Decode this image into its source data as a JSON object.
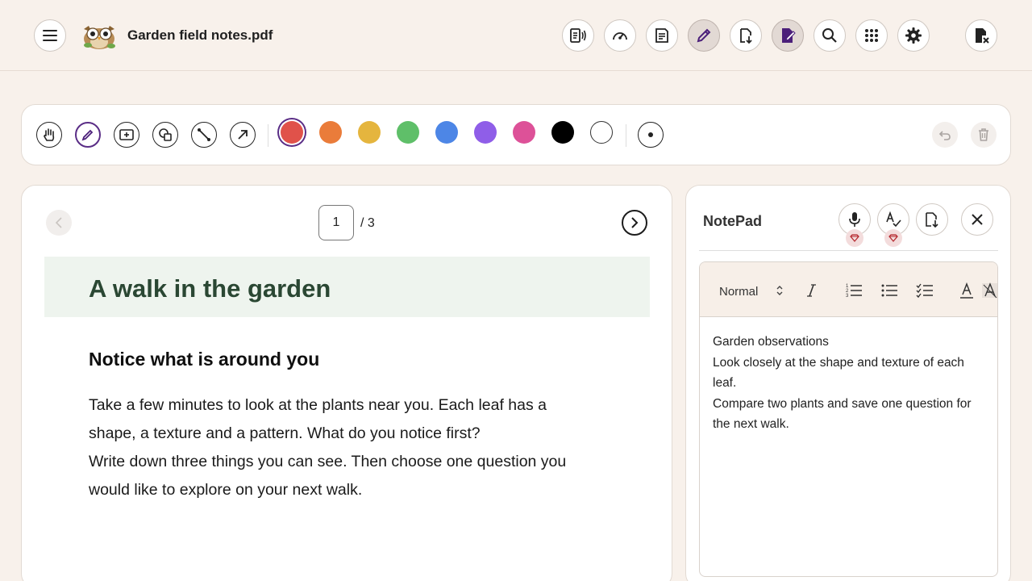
{
  "header": {
    "title": "Garden field notes.pdf",
    "toolbar_icons": [
      "read-aloud-icon",
      "speed-gauge-icon",
      "notes-icon",
      "pen-icon",
      "download-icon",
      "edit-document-icon",
      "search-icon",
      "apps-grid-icon",
      "settings-gear-icon",
      "exit-document-icon"
    ],
    "active_icon": "edit-document-icon"
  },
  "draw_toolbar": {
    "tools": [
      "pan-hand-icon",
      "pen-icon",
      "add-text-box-icon",
      "shapes-icon",
      "line-icon",
      "arrow-icon"
    ],
    "active_tool": "pen-icon",
    "colors": [
      "#e0524a",
      "#ea7c3a",
      "#e5b53e",
      "#5fbf69",
      "#4d86e6",
      "#8f5ee8",
      "#dd5198",
      "#000000",
      "#ffffff"
    ],
    "selected_color": "#e0524a",
    "extra_tools": [
      "stroke-size-icon",
      "undo-icon",
      "delete-icon"
    ]
  },
  "document": {
    "current_page": "1",
    "page_total": "/ 3",
    "heading": "A walk in the garden",
    "subheading": "Notice what is around you",
    "paragraphs": [
      "Take a few minutes to look at the plants near you. Each leaf has a shape, a texture and a pattern. What do you notice first?",
      "Write down three things you can see. Then choose one question you would like to explore on your next walk."
    ],
    "accent_color": "#2a4733"
  },
  "notepad": {
    "title": "NotePad",
    "buttons": [
      "microphone-icon",
      "spell-check-icon",
      "export-note-icon",
      "close-icon"
    ],
    "format_style": "Normal",
    "format_icons": [
      "italic-icon",
      "numbered-list-icon",
      "bullet-list-icon",
      "checklist-icon",
      "text-color-icon",
      "clear-format-icon"
    ],
    "content": [
      "Garden observations",
      "Look closely at the shape and texture of each leaf.",
      "Compare two plants and save one question for the next walk."
    ]
  }
}
